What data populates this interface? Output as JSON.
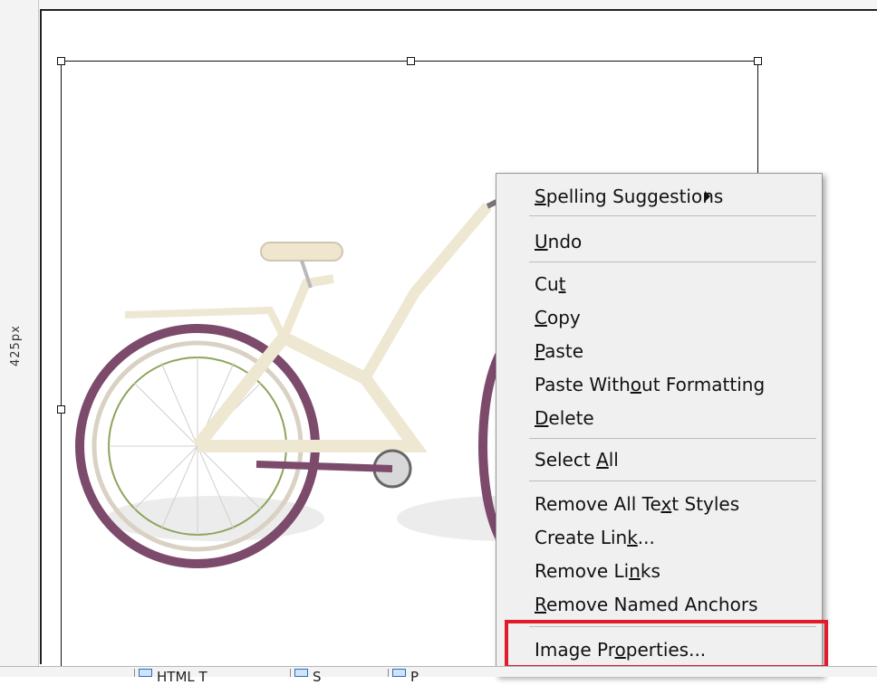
{
  "ruler": {
    "height_label": "425px"
  },
  "context_menu": {
    "items": [
      {
        "id": "spelling",
        "label_before": "",
        "underline": "S",
        "label_after": "pelling Suggestions",
        "has_submenu": true
      },
      {
        "id": "undo",
        "label_before": "",
        "underline": "U",
        "label_after": "ndo"
      },
      {
        "id": "cut",
        "label_before": "Cu",
        "underline": "t",
        "label_after": ""
      },
      {
        "id": "copy",
        "label_before": "",
        "underline": "C",
        "label_after": "opy"
      },
      {
        "id": "paste",
        "label_before": "",
        "underline": "P",
        "label_after": "aste"
      },
      {
        "id": "paste-without-formatting",
        "label_before": "Paste With",
        "underline": "o",
        "label_after": "ut Formatting"
      },
      {
        "id": "delete",
        "label_before": "",
        "underline": "D",
        "label_after": "elete"
      },
      {
        "id": "select-all",
        "label_before": "Select ",
        "underline": "A",
        "label_after": "ll"
      },
      {
        "id": "remove-all-text-styles",
        "label_before": "Remove All Te",
        "underline": "x",
        "label_after": "t Styles"
      },
      {
        "id": "create-link",
        "label_before": "Create Lin",
        "underline": "k",
        "label_after": "..."
      },
      {
        "id": "remove-links",
        "label_before": "Remove Li",
        "underline": "n",
        "label_after": "ks"
      },
      {
        "id": "remove-named-anchors",
        "label_before": "",
        "underline": "R",
        "label_after": "emove Named Anchors"
      },
      {
        "id": "image-properties",
        "label_before": "Image Pr",
        "underline": "o",
        "label_after": "perties..."
      }
    ]
  },
  "highlight": {
    "color": "#e21b2b"
  },
  "bottom_tabs": {
    "labels": [
      "HTML T",
      "S",
      "P"
    ]
  }
}
